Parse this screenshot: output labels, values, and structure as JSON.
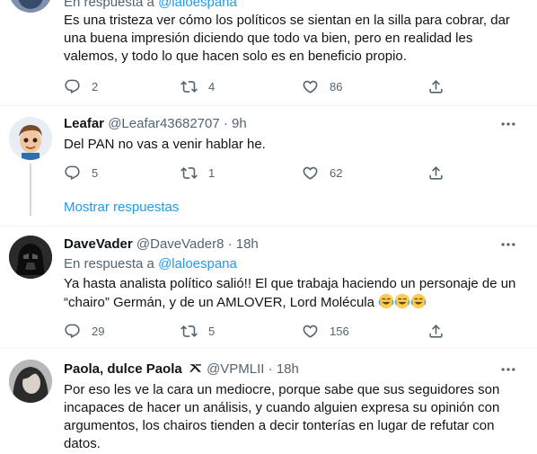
{
  "tweet1": {
    "reply_label": "En respuesta a",
    "reply_mention": "@laloespana",
    "text": "Es una tristeza ver cómo los políticos se sientan en la silla para cobrar, dar una buena impresión diciendo que todo va bien, pero en realidad les valemos, y todo lo que hacen solo es en beneficio propio.",
    "replies": "2",
    "retweets": "4",
    "likes": "86"
  },
  "tweet2": {
    "name": "Leafar",
    "handle": "@Leafar43682707",
    "sep": "·",
    "time": "9h",
    "text": "Del PAN no vas a venir hablar he.",
    "replies": "5",
    "retweets": "1",
    "likes": "62"
  },
  "show_more": "Mostrar respuestas",
  "tweet3": {
    "name": "DaveVader",
    "handle": "@DaveVader8",
    "sep": "·",
    "time": "18h",
    "reply_label": "En respuesta a",
    "reply_mention": "@laloespana",
    "text": "Ya hasta analista político salió!! El que trabaja haciendo un personaje de un “chairo” Germán, y de un AMLOVER, Lord Molécula",
    "replies": "29",
    "retweets": "5",
    "likes": "156"
  },
  "tweet4": {
    "name": "Paola, dulce Paola",
    "handle": "@VPMLII",
    "sep": "·",
    "time": "18h",
    "text": "Por eso les ve la cara un mediocre, porque sabe que sus seguidores son incapaces de hacer un análisis, y cuando alguien expresa su opinión con argumentos, los chairos tienden a decir tonterías en lugar de refutar con datos."
  },
  "icons": {
    "reply": "reply-icon",
    "retweet": "retweet-icon",
    "like": "heart-icon",
    "share": "share-icon",
    "more": "more-icon",
    "verified": "verified-icon",
    "emoji": "joy-emoji-icon"
  },
  "colors": {
    "accent": "#1d9bf0",
    "secondary_text": "#536471",
    "primary_text": "#0f1419",
    "divider": "#eff3f4"
  }
}
